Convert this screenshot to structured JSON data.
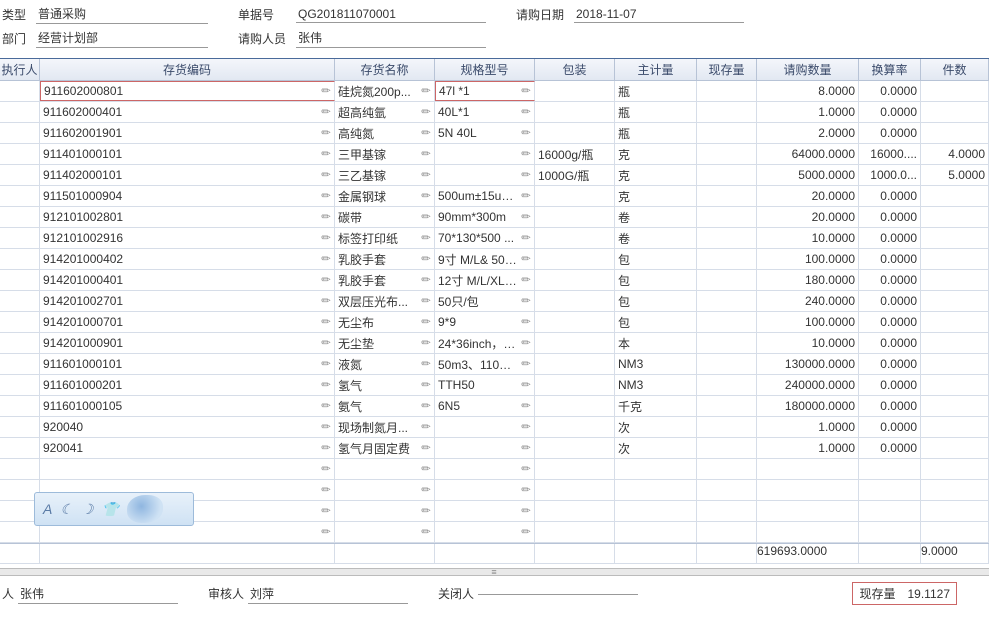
{
  "header": {
    "type_label": "类型",
    "type_value": "普通采购",
    "doc_label": "单据号",
    "doc_value": "QG201811070001",
    "reqdate_label": "请购日期",
    "reqdate_value": "2018-11-07",
    "dept_label": "部门",
    "dept_value": "经营计划部",
    "reqperson_label": "请购人员",
    "reqperson_value": "张伟"
  },
  "columns": {
    "exec": "执行人",
    "code": "存货编码",
    "name": "存货名称",
    "spec": "规格型号",
    "pack": "包装",
    "uom": "主计量",
    "onhand": "现存量",
    "qty": "请购数量",
    "conv": "换算率",
    "pcs": "件数"
  },
  "rows": [
    {
      "code": "911602000801",
      "name": "硅烷氮200p...",
      "spec": "47l *1",
      "pack": "",
      "uom": "瓶",
      "qty": "8.0000",
      "conv": "0.0000",
      "pcs": ""
    },
    {
      "code": "911602000401",
      "name": "超高纯氩",
      "spec": "40L*1",
      "pack": "",
      "uom": "瓶",
      "qty": "1.0000",
      "conv": "0.0000",
      "pcs": ""
    },
    {
      "code": "911602001901",
      "name": "高纯氮",
      "spec": "5N 40L",
      "pack": "",
      "uom": "瓶",
      "qty": "2.0000",
      "conv": "0.0000",
      "pcs": ""
    },
    {
      "code": "911401000101",
      "name": "三甲基镓",
      "spec": "",
      "pack": "16000g/瓶",
      "uom": "克",
      "qty": "64000.0000",
      "conv": "16000....",
      "pcs": "4.0000"
    },
    {
      "code": "911402000101",
      "name": "三乙基镓",
      "spec": "",
      "pack": "1000G/瓶",
      "uom": "克",
      "qty": "5000.0000",
      "conv": "1000.0...",
      "pcs": "5.0000"
    },
    {
      "code": "911501000904",
      "name": "金属钢球",
      "spec": "500um±15um...",
      "pack": "",
      "uom": "克",
      "qty": "20.0000",
      "conv": "0.0000",
      "pcs": ""
    },
    {
      "code": "912101002801",
      "name": "碳带",
      "spec": "90mm*300m",
      "pack": "",
      "uom": "卷",
      "qty": "20.0000",
      "conv": "0.0000",
      "pcs": ""
    },
    {
      "code": "912101002916",
      "name": "标签打印纸",
      "spec": "70*130*500 ...",
      "pack": "",
      "uom": "卷",
      "qty": "10.0000",
      "conv": "0.0000",
      "pcs": ""
    },
    {
      "code": "914201000402",
      "name": "乳胶手套",
      "spec": "9寸 M/L& 50pc...",
      "pack": "",
      "uom": "包",
      "qty": "100.0000",
      "conv": "0.0000",
      "pcs": ""
    },
    {
      "code": "914201000401",
      "name": "乳胶手套",
      "spec": "12寸 M/L/XL&...",
      "pack": "",
      "uom": "包",
      "qty": "180.0000",
      "conv": "0.0000",
      "pcs": ""
    },
    {
      "code": "914201002701",
      "name": "双层压光布...",
      "spec": "50只/包",
      "pack": "",
      "uom": "包",
      "qty": "240.0000",
      "conv": "0.0000",
      "pcs": ""
    },
    {
      "code": "914201000701",
      "name": "无尘布",
      "spec": "9*9",
      "pack": "",
      "uom": "包",
      "qty": "100.0000",
      "conv": "0.0000",
      "pcs": ""
    },
    {
      "code": "914201000901",
      "name": "无尘垫",
      "spec": "24*36inch，3...",
      "pack": "",
      "uom": "本",
      "qty": "10.0000",
      "conv": "0.0000",
      "pcs": ""
    },
    {
      "code": "911601000101",
      "name": "液氮",
      "spec": "50m3、110m3...",
      "pack": "",
      "uom": "NM3",
      "qty": "130000.0000",
      "conv": "0.0000",
      "pcs": ""
    },
    {
      "code": "911601000201",
      "name": "氢气",
      "spec": "TTH50",
      "pack": "",
      "uom": "NM3",
      "qty": "240000.0000",
      "conv": "0.0000",
      "pcs": ""
    },
    {
      "code": "911601000105",
      "name": "氨气",
      "spec": "6N5",
      "pack": "",
      "uom": "千克",
      "qty": "180000.0000",
      "conv": "0.0000",
      "pcs": ""
    },
    {
      "code": "920040",
      "name": "现场制氮月...",
      "spec": "",
      "pack": "",
      "uom": "次",
      "qty": "1.0000",
      "conv": "0.0000",
      "pcs": ""
    },
    {
      "code": "920041",
      "name": "氢气月固定费",
      "spec": "",
      "pack": "",
      "uom": "次",
      "qty": "1.0000",
      "conv": "0.0000",
      "pcs": ""
    }
  ],
  "totals": {
    "qty": "619693.0000",
    "pcs": "9.0000"
  },
  "footer": {
    "maker_label": "人",
    "maker_value": "张伟",
    "auditor_label": "审核人",
    "auditor_value": "刘萍",
    "closer_label": "关闭人",
    "closer_value": "",
    "stock_label": "现存量",
    "stock_value": "19.1127"
  },
  "widget": {
    "text": "A"
  }
}
